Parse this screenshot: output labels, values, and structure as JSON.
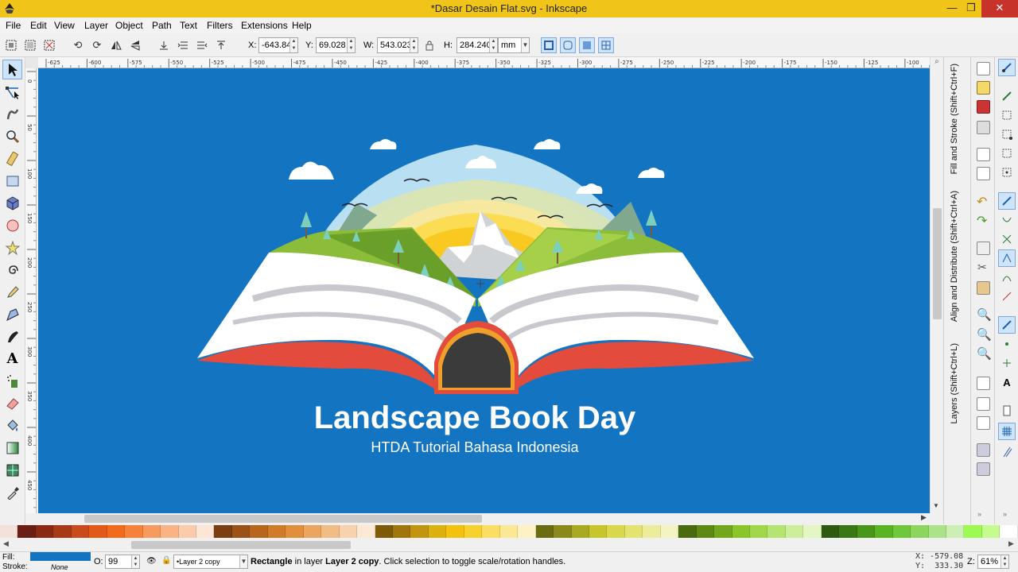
{
  "window": {
    "title": "*Dasar Desain Flat.svg - Inkscape",
    "minimize": "—",
    "maximize": "❐",
    "close": "✕"
  },
  "menu": [
    "File",
    "Edit",
    "View",
    "Layer",
    "Object",
    "Path",
    "Text",
    "Filters",
    "Extensions",
    "Help"
  ],
  "controls": {
    "x_label": "X:",
    "x_value": "-643.84",
    "y_label": "Y:",
    "y_value": "69.028",
    "w_label": "W:",
    "w_value": "543.023",
    "h_label": "H:",
    "h_value": "284.240",
    "unit": "mm"
  },
  "ruler_h": [
    "-625",
    "-600",
    "-575",
    "-550",
    "-525",
    "-500",
    "-475",
    "-450",
    "-425",
    "-400",
    "-375",
    "-350",
    "-325",
    "-300",
    "-275",
    "-250",
    "-225",
    "-200",
    "-175",
    "-150",
    "-125",
    "-100"
  ],
  "ruler_v": [
    "0",
    "50",
    "100",
    "150",
    "200",
    "250",
    "300",
    "350",
    "400",
    "450"
  ],
  "artwork": {
    "title": "Landscape Book Day",
    "subtitle": "HTDA Tutorial Bahasa Indonesia",
    "background": "#1375c2"
  },
  "dock": {
    "fill_stroke": "Fill and Stroke (Shift+Ctrl+F)",
    "align": "Align and Distribute (Shift+Ctrl+A)",
    "layers": "Layers (Shift+Ctrl+L)"
  },
  "status": {
    "fill_label": "Fill:",
    "stroke_label": "Stroke:",
    "stroke_value": "None",
    "fill_color": "#1375c2",
    "opacity_label": "O:",
    "opacity_value": "99",
    "layer": "•Layer 2 copy",
    "message_bold": "Rectangle",
    "message_mid": " in layer ",
    "message_layer": "Layer 2 copy",
    "message_tail": ". Click selection to toggle scale/rotation handles.",
    "coord_x": "X: -579.08",
    "coord_y": "Y:  333.30",
    "zoom_label": "Z:",
    "zoom_value": "61%"
  },
  "palette": [
    "#f2e2d9",
    "#6b1f14",
    "#8a2a12",
    "#a93a16",
    "#c94a1a",
    "#e25a18",
    "#f26a1c",
    "#f5813a",
    "#f79a5e",
    "#f9b385",
    "#fbccac",
    "#fde6d5",
    "#7a3e12",
    "#9a5218",
    "#b8661e",
    "#d17a28",
    "#e18f3c",
    "#eba55e",
    "#f2bc85",
    "#f7d3ad",
    "#fbe9d6",
    "#7d5a06",
    "#a0760a",
    "#c29510",
    "#dcb10e",
    "#f2c20c",
    "#f7d22e",
    "#f9de63",
    "#fbe894",
    "#fdf2c4",
    "#6b6b12",
    "#8a8a1a",
    "#a9a922",
    "#c6c62c",
    "#d8d84a",
    "#e3e372",
    "#ecec9a",
    "#f4f4c2",
    "#4a6a10",
    "#5e8a14",
    "#74a81c",
    "#8ac62a",
    "#a0d84a",
    "#b6e472",
    "#cdee9a",
    "#e3f6c4",
    "#2e5a10",
    "#3a7814",
    "#48961a",
    "#58b422",
    "#6ec83a",
    "#8cd660",
    "#acE28a",
    "#ccefb4",
    "#9dfa52",
    "#c4fc8e",
    "#ffffff"
  ]
}
